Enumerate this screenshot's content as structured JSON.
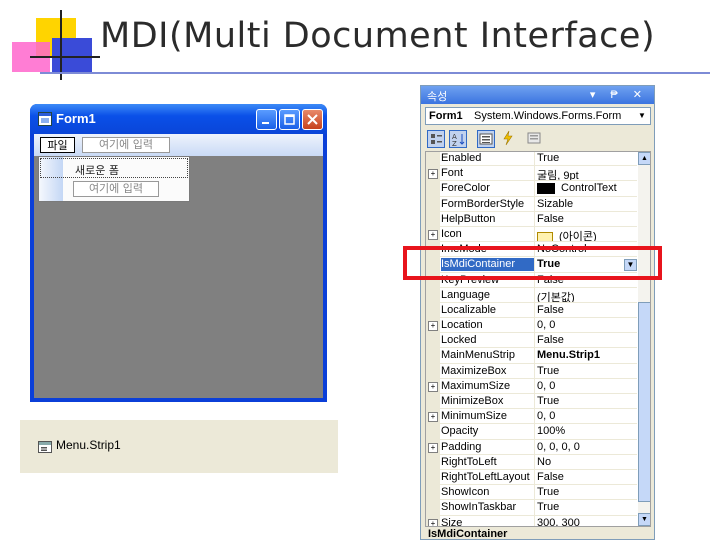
{
  "slide": {
    "title": "MDI(Multi Document Interface)"
  },
  "form_window": {
    "title": "Form1",
    "menu": {
      "file_label": "파일",
      "type_here": "여기에 입력"
    },
    "dropdown": {
      "item_label": "새로운 폼",
      "type_here": "여기에 입력"
    }
  },
  "tray": {
    "component_label": "Menu.Strip1"
  },
  "properties": {
    "title": "속성",
    "caption_icons": "▾ ₱ ✕",
    "selector": {
      "name": "Form1",
      "type": "System.Windows.Forms.Form"
    },
    "rows": [
      {
        "name": "Enabled",
        "value": "True"
      },
      {
        "name": "Font",
        "value": "굴림, 9pt",
        "expandable": true
      },
      {
        "name": "ForeColor",
        "value": "ControlText",
        "swatch": "#000000"
      },
      {
        "name": "FormBorderStyle",
        "value": "Sizable"
      },
      {
        "name": "HelpButton",
        "value": "False"
      },
      {
        "name": "Icon",
        "value": "(아이콘)",
        "expandable": true
      },
      {
        "name": "ImeMode",
        "value": "NoControl"
      },
      {
        "name": "IsMdiContainer",
        "value": "True",
        "selected": true
      },
      {
        "name": "KeyPreview",
        "value": "False"
      },
      {
        "name": "Language",
        "value": "(기본값)"
      },
      {
        "name": "Localizable",
        "value": "False"
      },
      {
        "name": "Location",
        "value": "0, 0",
        "expandable": true
      },
      {
        "name": "Locked",
        "value": "False"
      },
      {
        "name": "MainMenuStrip",
        "value": "Menu.Strip1",
        "bold": true
      },
      {
        "name": "MaximizeBox",
        "value": "True"
      },
      {
        "name": "MaximumSize",
        "value": "0, 0",
        "expandable": true
      },
      {
        "name": "MinimizeBox",
        "value": "True"
      },
      {
        "name": "MinimumSize",
        "value": "0, 0",
        "expandable": true
      },
      {
        "name": "Opacity",
        "value": "100%"
      },
      {
        "name": "Padding",
        "value": "0, 0, 0, 0",
        "expandable": true
      },
      {
        "name": "RightToLeft",
        "value": "No"
      },
      {
        "name": "RightToLeftLayout",
        "value": "False"
      },
      {
        "name": "ShowIcon",
        "value": "True"
      },
      {
        "name": "ShowInTaskbar",
        "value": "True"
      },
      {
        "name": "Size",
        "value": "300, 300",
        "expandable": true
      }
    ],
    "description_title": "IsMdiContainer"
  },
  "colors": {
    "highlight": "#e8141c",
    "selected_row": "#316ac5",
    "titlebar": "#0a50e8"
  }
}
